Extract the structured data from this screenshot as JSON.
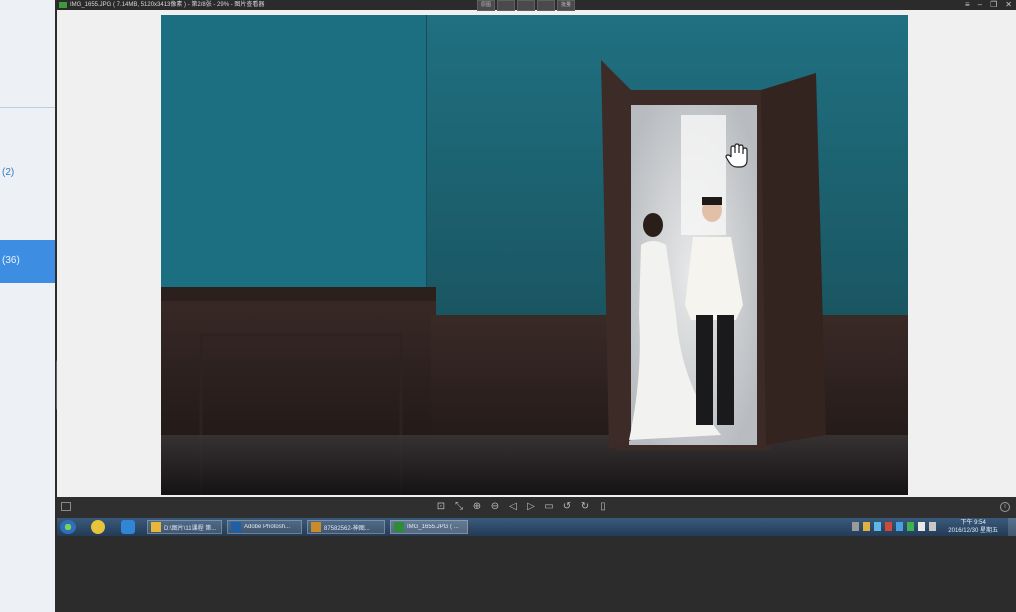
{
  "sidebar": {
    "item_count_a": "(2)",
    "item_count_b": "(36)"
  },
  "viewer": {
    "title": "IMG_1655.JPG ( 7.14MB, 5120x3413像素 ) - 第2/8张 - 29% - 图片查看器",
    "mode_buttons": [
      "原图",
      "",
      "",
      "",
      "批量"
    ],
    "window_controls": [
      "≡",
      "–",
      "❐",
      "✕"
    ],
    "toolbar": {
      "tools": [
        "actual-size",
        "fit-window",
        "zoom-in",
        "zoom-out",
        "previous",
        "next",
        "slideshow",
        "rotate-left",
        "rotate-right",
        "delete"
      ]
    }
  },
  "taskbar": {
    "tasks": [
      {
        "label": "D:\\图片\\11课程 第...",
        "color": "#e8b73a"
      },
      {
        "label": "Adobe Photosh...",
        "color": "#1f5fa8"
      },
      {
        "label": "87582562-神图...",
        "color": "#c98b2b"
      },
      {
        "label": "IMG_1655.JPG ( ...",
        "color": "#2e8b3a"
      }
    ],
    "clock_time": "下午 9:54",
    "clock_date": "2016/12/30 星期五"
  }
}
